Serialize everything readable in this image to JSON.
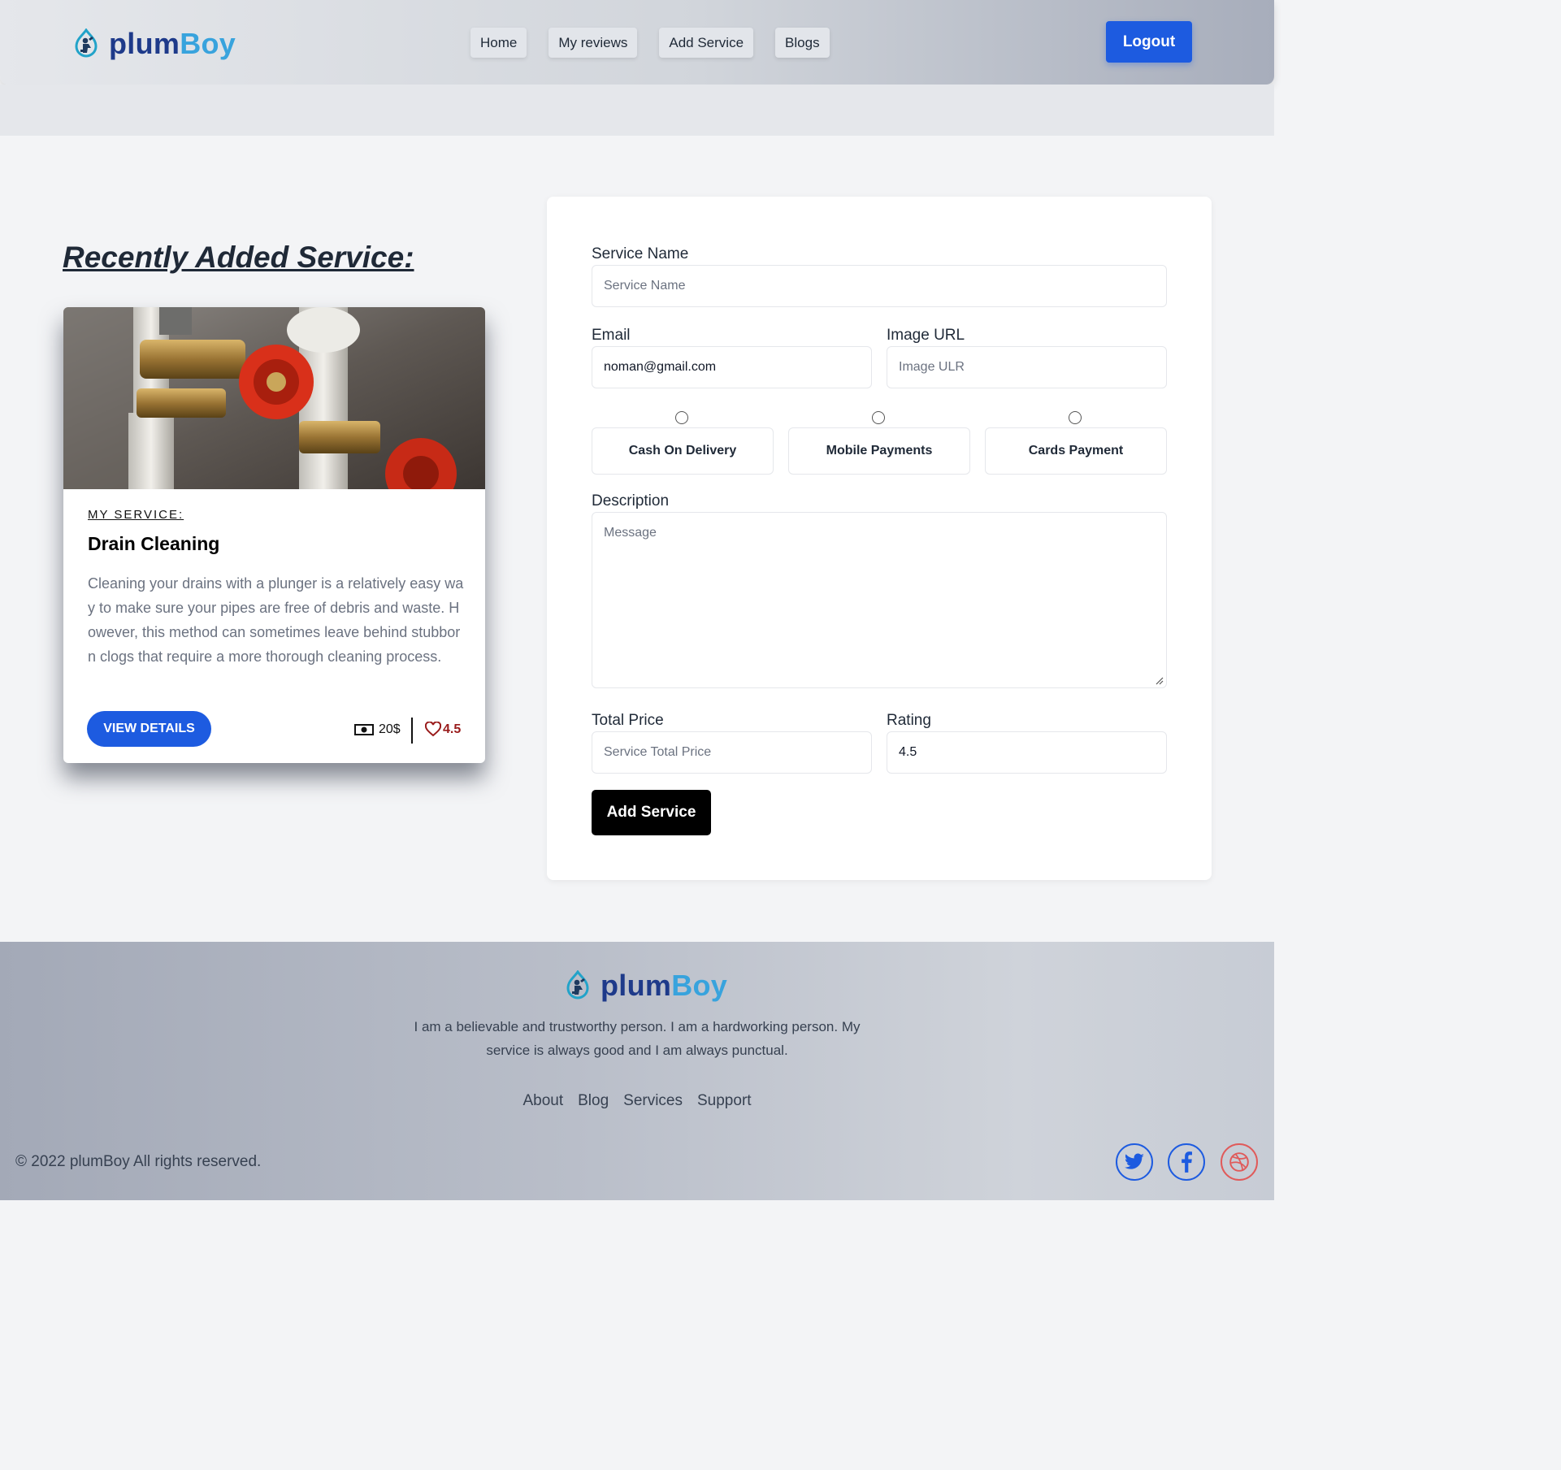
{
  "brand": {
    "name_part1": "plum",
    "name_part2": "Boy"
  },
  "nav": {
    "items": [
      {
        "label": "Home"
      },
      {
        "label": "My reviews"
      },
      {
        "label": "Add Service"
      },
      {
        "label": "Blogs"
      }
    ]
  },
  "header": {
    "logout_label": "Logout"
  },
  "recent": {
    "title": "Recently Added Service:",
    "card": {
      "tag": "MY SERVICE:",
      "name": "Drain Cleaning",
      "description": "Cleaning your drains with a plunger is a relatively easy way to make sure your pipes are free of debris and waste. However, this method can sometimes leave behind stubborn clogs that require a more thorough cleaning process.",
      "button": "VIEW DETAILS",
      "price": "20$",
      "rating": "4.5"
    }
  },
  "form": {
    "service_name": {
      "label": "Service Name",
      "placeholder": "Service Name"
    },
    "email": {
      "label": "Email",
      "value": "noman@gmail.com"
    },
    "image_url": {
      "label": "Image URL",
      "placeholder": "Image ULR"
    },
    "payments": [
      {
        "label": "Cash On Delivery"
      },
      {
        "label": "Mobile Payments"
      },
      {
        "label": "Cards Payment"
      }
    ],
    "description": {
      "label": "Description",
      "placeholder": "Message"
    },
    "total_price": {
      "label": "Total Price",
      "placeholder": "Service Total Price"
    },
    "rating": {
      "label": "Rating",
      "value": "4.5"
    },
    "submit": "Add Service"
  },
  "footer": {
    "about": "I am a believable and trustworthy person. I am a hardworking person. My service is always good and I am always punctual.",
    "links": [
      {
        "label": "About"
      },
      {
        "label": "Blog"
      },
      {
        "label": "Services"
      },
      {
        "label": "Support"
      }
    ],
    "copyright": "© 2022 plumBoy All rights reserved.",
    "social": [
      {
        "icon": "twitter-icon"
      },
      {
        "icon": "facebook-icon"
      },
      {
        "icon": "dribbble-icon"
      }
    ]
  },
  "colors": {
    "primary": "#1d5be0",
    "brand_dark": "#1e3a8a",
    "brand_light": "#38a3dd",
    "rating": "#991b1b",
    "dribbble": "#e05a5a"
  }
}
